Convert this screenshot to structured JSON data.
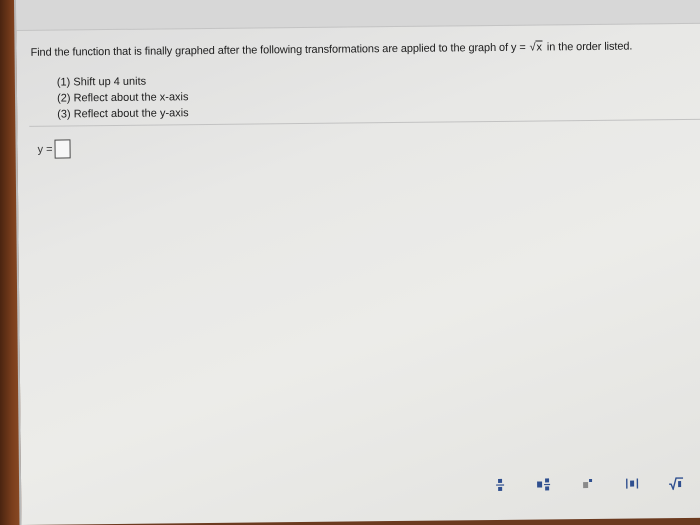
{
  "question": {
    "prefix": "Find the function that is finally graphed after the following transformations are applied to the graph of y = ",
    "sqrt_arg": "x",
    "suffix": " in the order listed."
  },
  "steps": [
    "(1) Shift up 4 units",
    "(2) Reflect about the x-axis",
    "(3) Reflect about the y-axis"
  ],
  "answer": {
    "label": "y =",
    "value": ""
  },
  "toolbar": {
    "icons": [
      "fraction-icon",
      "mixed-number-icon",
      "exponent-icon",
      "absolute-value-icon",
      "square-root-icon",
      "nth-root-icon"
    ]
  },
  "colors": {
    "text": "#1d1d1d",
    "toolbar_icon": "#2f4f8f"
  }
}
